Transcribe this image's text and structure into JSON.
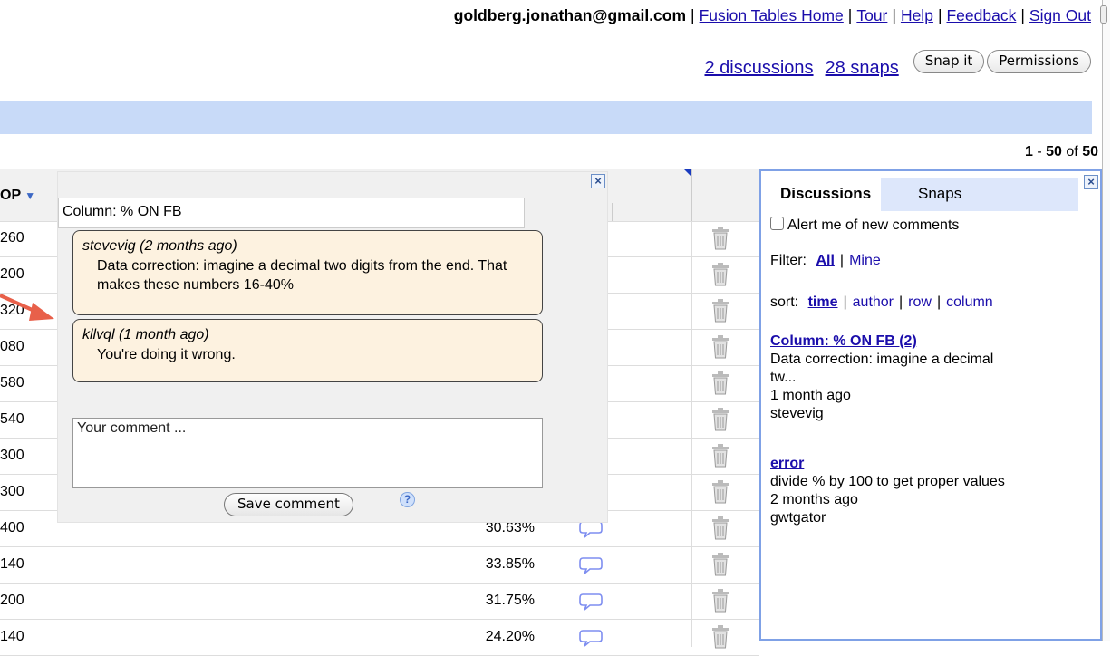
{
  "header": {
    "email": "goldberg.jonathan@gmail.com",
    "links": [
      "Fusion Tables Home",
      "Tour",
      "Help",
      "Feedback",
      "Sign Out"
    ]
  },
  "toolbar": {
    "discussions_link": "2 discussions",
    "snaps_link": "28 snaps",
    "snap_button": "Snap it",
    "permissions_button": "Permissions"
  },
  "pagination": {
    "start": "1",
    "end": "50",
    "of": "of",
    "total": "50"
  },
  "table": {
    "column_header_fragment": "OP",
    "rows": [
      {
        "c0": "260",
        "pct": "",
        "bubble": false
      },
      {
        "c0": "200",
        "pct": "",
        "bubble": false
      },
      {
        "c0": "320",
        "pct": "",
        "bubble": false
      },
      {
        "c0": "080",
        "pct": "",
        "bubble": false
      },
      {
        "c0": "580",
        "pct": "",
        "bubble": false
      },
      {
        "c0": "540",
        "pct": "",
        "bubble": false
      },
      {
        "c0": "300",
        "pct": "",
        "bubble": false
      },
      {
        "c0": "300",
        "pct": "",
        "bubble": false
      },
      {
        "c0": "400",
        "pct": "30.63%",
        "bubble": true
      },
      {
        "c0": "140",
        "pct": "33.85%",
        "bubble": true
      },
      {
        "c0": "200",
        "pct": "31.75%",
        "bubble": true
      },
      {
        "c0": "140",
        "pct": "24.20%",
        "bubble": true
      }
    ]
  },
  "popup": {
    "column_title": "Column: % ON FB",
    "comments": [
      {
        "author": "stevevig (2 months ago)",
        "text": "Data correction: imagine a decimal two digits from the end. That makes these numbers 16-40%"
      },
      {
        "author": "kllvql (1 month ago)",
        "text": "You're doing it wrong."
      }
    ],
    "comment_placeholder": "Your comment ...",
    "save_button": "Save comment",
    "help_symbol": "?",
    "close_symbol": "×"
  },
  "panel": {
    "tab_discussions": "Discussions",
    "tab_snaps": "Snaps",
    "alert_label": "Alert me of new comments",
    "filter_label": "Filter:",
    "filter_all": "All",
    "filter_mine": "Mine",
    "sort_label": "sort:",
    "sort_time": "time",
    "sort_author": "author",
    "sort_row": "row",
    "sort_column": "column",
    "entries": [
      {
        "title": "Column: % ON FB (2)",
        "lines": [
          "Data correction: imagine a decimal",
          "tw...",
          "1 month ago",
          "stevevig"
        ]
      },
      {
        "title": "error",
        "lines": [
          "divide % by 100 to get proper values",
          "2 months ago",
          "gwtgator"
        ]
      }
    ]
  },
  "colors": {
    "link": "#1a0dab",
    "bluebar": "#c8daf8",
    "comment_bg": "#fdf2e0",
    "panel_border": "#7fa1e6",
    "arrow": "#e8604a"
  }
}
